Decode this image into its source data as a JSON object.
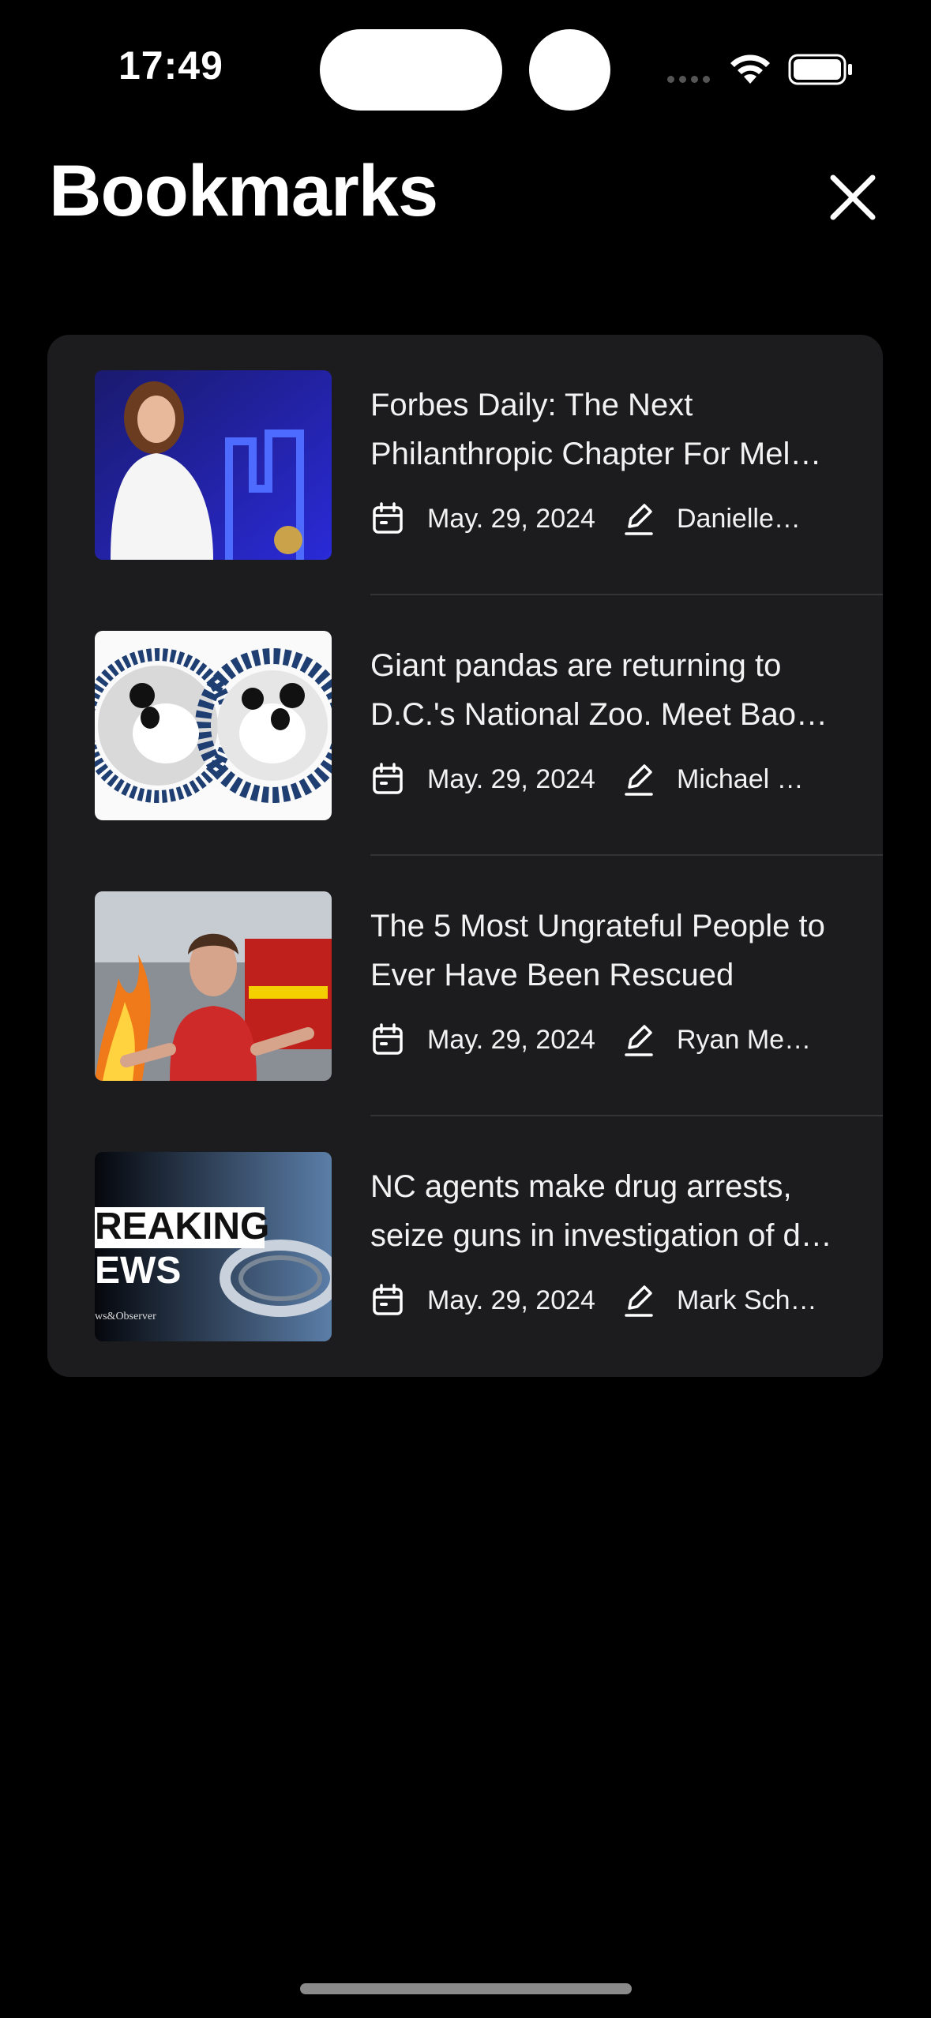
{
  "status_bar": {
    "time": "17:49"
  },
  "header": {
    "title": "Bookmarks",
    "close_icon": "close-icon"
  },
  "bookmarks": [
    {
      "title": "Forbes Daily: The Next Philanthropic Chapter For Mel…",
      "date": "May. 29, 2024",
      "author": "Danielle…",
      "thumb_icon": "photo-woman-on-stage"
    },
    {
      "title": "Giant pandas are returning to D.C.'s National Zoo. Meet Bao…",
      "date": "May. 29, 2024",
      "author": "Michael E…",
      "thumb_icon": "photo-pandas"
    },
    {
      "title": "The 5 Most Ungrateful People to Ever Have Been Rescued",
      "date": "May. 29, 2024",
      "author": "Ryan Men…",
      "thumb_icon": "photo-rescue-fire"
    },
    {
      "title": "NC agents make drug arrests, seize guns in investigation of d…",
      "date": "May. 29, 2024",
      "author": "Mark Sch…",
      "thumb_icon": "photo-breaking-news",
      "thumb_text": [
        "REAKING",
        "EWS"
      ],
      "thumb_caption": "ws&Observer"
    }
  ]
}
